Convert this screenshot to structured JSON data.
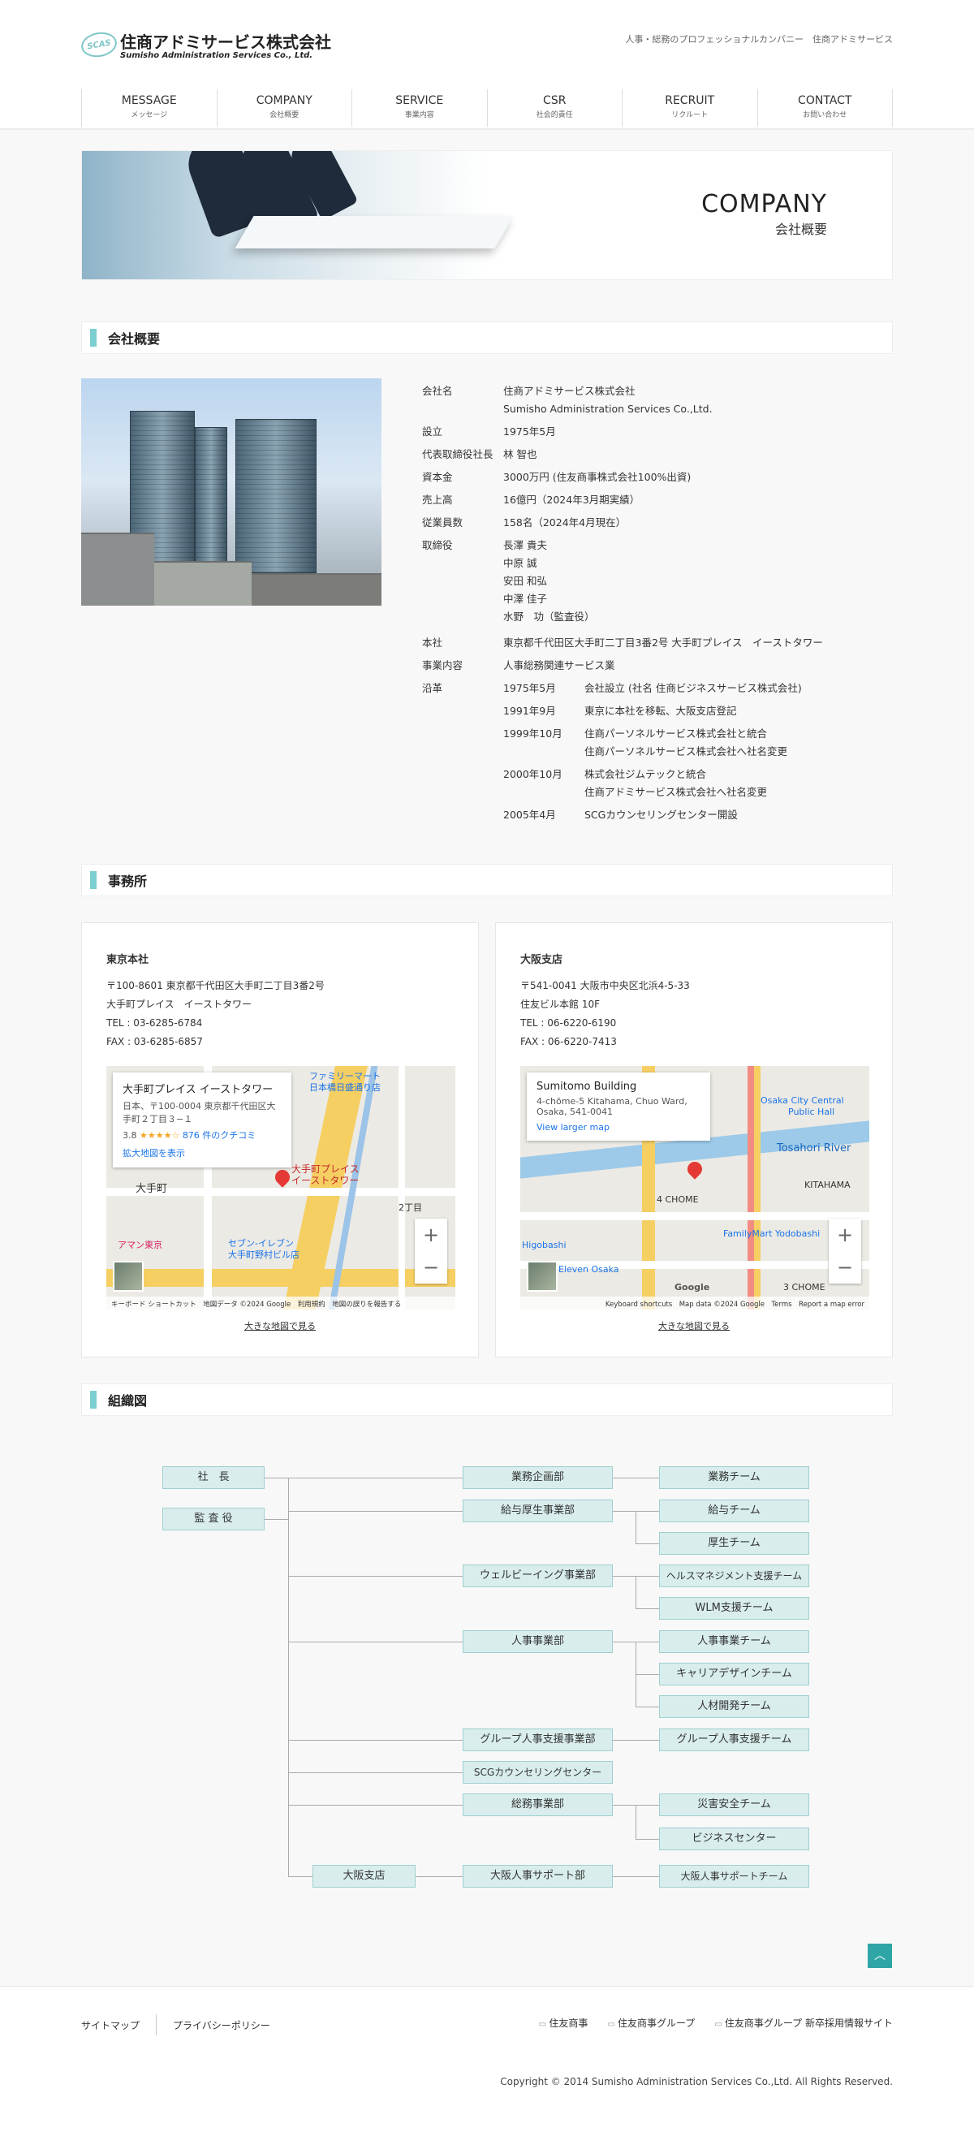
{
  "header": {
    "logo_mark": "SCAS",
    "logo_ja": "住商アドミサービス株式会社",
    "logo_en": "Sumisho Administration Services Co., Ltd.",
    "tagline": "人事・総務のプロフェッショナルカンパニー　住商アドミサービス"
  },
  "nav": [
    {
      "en": "MESSAGE",
      "ja": "メッセージ"
    },
    {
      "en": "COMPANY",
      "ja": "会社概要"
    },
    {
      "en": "SERVICE",
      "ja": "事業内容"
    },
    {
      "en": "CSR",
      "ja": "社会的責任"
    },
    {
      "en": "RECRUIT",
      "ja": "リクルート"
    },
    {
      "en": "CONTACT",
      "ja": "お問い合わせ"
    }
  ],
  "hero": {
    "en": "COMPANY",
    "ja": "会社概要"
  },
  "sections": {
    "overview": "会社概要",
    "offices": "事務所",
    "org": "組織図"
  },
  "overview": {
    "company_name_label": "会社名",
    "company_name_ja": "住商アドミサービス株式会社",
    "company_name_en": "Sumisho Administration Services Co.,Ltd.",
    "established_label": "設立",
    "established": "1975年5月",
    "president_label": "代表取締役社長",
    "president": "林 智也",
    "capital_label": "資本金",
    "capital": "3000万円 (住友商事株式会社100%出資)",
    "sales_label": "売上高",
    "sales": "16億円（2024年3月期実績）",
    "employees_label": "従業員数",
    "employees": "158名（2024年4月現在）",
    "directors_label": "取締役",
    "directors": [
      "長澤 貴夫",
      "中原 誠",
      "安田 和弘",
      "中澤 佳子",
      "水野　功（監査役）"
    ],
    "hq_label": "本社",
    "hq": "東京都千代田区大手町二丁目3番2号 大手町プレイス　イーストタワー",
    "business_label": "事業内容",
    "business": "人事総務関連サービス業",
    "history_label": "沿革",
    "history": [
      {
        "date": "1975年5月",
        "lines": [
          "会社設立 (社名 住商ビジネスサービス株式会社)"
        ]
      },
      {
        "date": "1991年9月",
        "lines": [
          "東京に本社を移転、大阪支店登記"
        ]
      },
      {
        "date": "1999年10月",
        "lines": [
          "住商パーソネルサービス株式会社と統合",
          "住商パーソネルサービス株式会社へ社名変更"
        ]
      },
      {
        "date": "2000年10月",
        "lines": [
          "株式会社ジムテックと統合",
          "住商アドミサービス株式会社へ社名変更"
        ]
      },
      {
        "date": "2005年4月",
        "lines": [
          "SCGカウンセリングセンター開設"
        ]
      }
    ]
  },
  "offices": [
    {
      "name": "東京本社",
      "address": [
        "〒100-8601 東京都千代田区大手町二丁目3番2号",
        "大手町プレイス　イーストタワー",
        "TEL : 03-6285-6784",
        "FAX : 03-6285-6857"
      ],
      "map_card_title": "大手町プレイス イーストタワー",
      "map_card_address": "日本、〒100-0004 東京都千代田区大手町２丁目３−１",
      "map_rating": "3.8",
      "map_stars": "★★★★☆",
      "map_reviews": "876 件のクチコミ",
      "map_link": "拡大地図を表示",
      "map_footer": "キーボード ショートカット　地図データ ©2024 Google　利用規約　地図の誤りを報告する",
      "map_labels": [
        "ファミリーマート",
        "日本橋日盛通り店",
        "大手町プレイス",
        "イーストタワー",
        "大手町",
        "アマン東京",
        "セブン-イレブン",
        "大手町野村ビル店",
        "2丁目"
      ],
      "big_map": "大きな地図で見る"
    },
    {
      "name": "大阪支店",
      "address": [
        "〒541-0041 大阪市中央区北浜4-5-33",
        "住友ビル本館 10F",
        "TEL : 06-6220-6190",
        "FAX : 06-6220-7413"
      ],
      "map_card_title": "Sumitomo Building",
      "map_card_address": "4-chōme-5 Kitahama, Chuo Ward, Osaka, 541-0041",
      "map_link": "View larger map",
      "map_footer": "Keyboard shortcuts　Map data ©2024 Google　Terms　Report a map error",
      "map_labels": [
        "Osaka City Central",
        "Public Hall",
        "Tosahori River",
        "KITAHAMA",
        "4 CHOME",
        "FamilyMart Yodobashi",
        "Higobashi",
        "7-Eleven Osaka",
        "3 CHOME",
        "Google"
      ],
      "big_map": "大きな地図で見る"
    }
  ],
  "org": {
    "president": "社　長",
    "auditor": "監 査 役",
    "osaka_branch": "大阪支店",
    "departments": [
      "業務企画部",
      "給与厚生事業部",
      "ウェルビーイング事業部",
      "人事事業部",
      "グループ人事支援事業部",
      "SCGカウンセリングセンター",
      "総務事業部",
      "大阪人事サポート部"
    ],
    "teams": [
      "業務チーム",
      "給与チーム",
      "厚生チーム",
      "ヘルスマネジメント支援チーム",
      "WLM支援チーム",
      "人事事業チーム",
      "キャリアデザインチーム",
      "人材開発チーム",
      "グループ人事支援チーム",
      "災害安全チーム",
      "ビジネスセンター",
      "大阪人事サポートチーム"
    ]
  },
  "to_top": "︿",
  "footer": {
    "left": [
      "サイトマップ",
      "プライバシーポリシー"
    ],
    "right": [
      "住友商事",
      "住友商事グループ",
      "住友商事グループ 新卒採用情報サイト"
    ],
    "copyright": "Copyright © 2014 Sumisho Administration Services Co.,Ltd. All Rights Reserved."
  },
  "colors": {
    "accent": "#7ccfd0",
    "org_box": "#d9eded",
    "to_top": "#2fa5a6"
  }
}
